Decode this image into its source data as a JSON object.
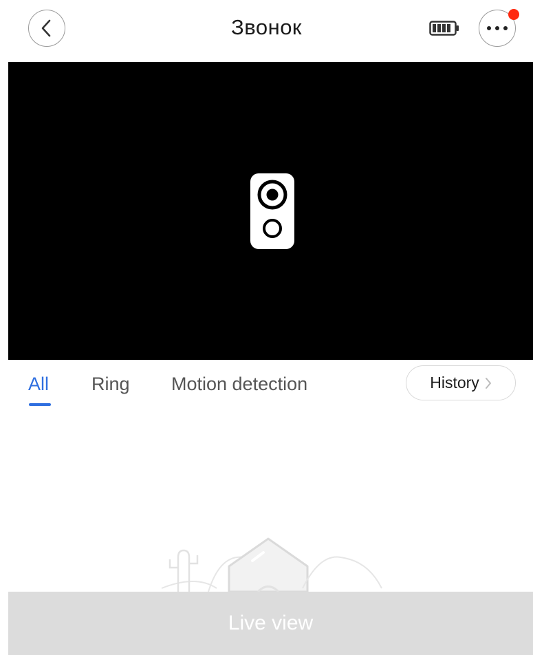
{
  "header": {
    "title": "Звонок",
    "back_icon": "chevron-left-icon",
    "battery_icon": "battery-full-icon",
    "more_icon": "ellipsis-icon",
    "notification_color": "#ff2a10"
  },
  "video": {
    "placeholder_icon": "doorbell-icon",
    "background": "#000000"
  },
  "tabs": [
    {
      "label": "All",
      "active": true
    },
    {
      "label": "Ring",
      "active": false
    },
    {
      "label": "Motion detection",
      "active": false
    }
  ],
  "history": {
    "label": "History",
    "icon": "chevron-right-icon"
  },
  "empty_state": {
    "icon": "house-cactus-illustration"
  },
  "live_view": {
    "label": "Live view"
  },
  "colors": {
    "accent": "#2f6fe0",
    "disabled_bar": "#dcdcdc"
  }
}
